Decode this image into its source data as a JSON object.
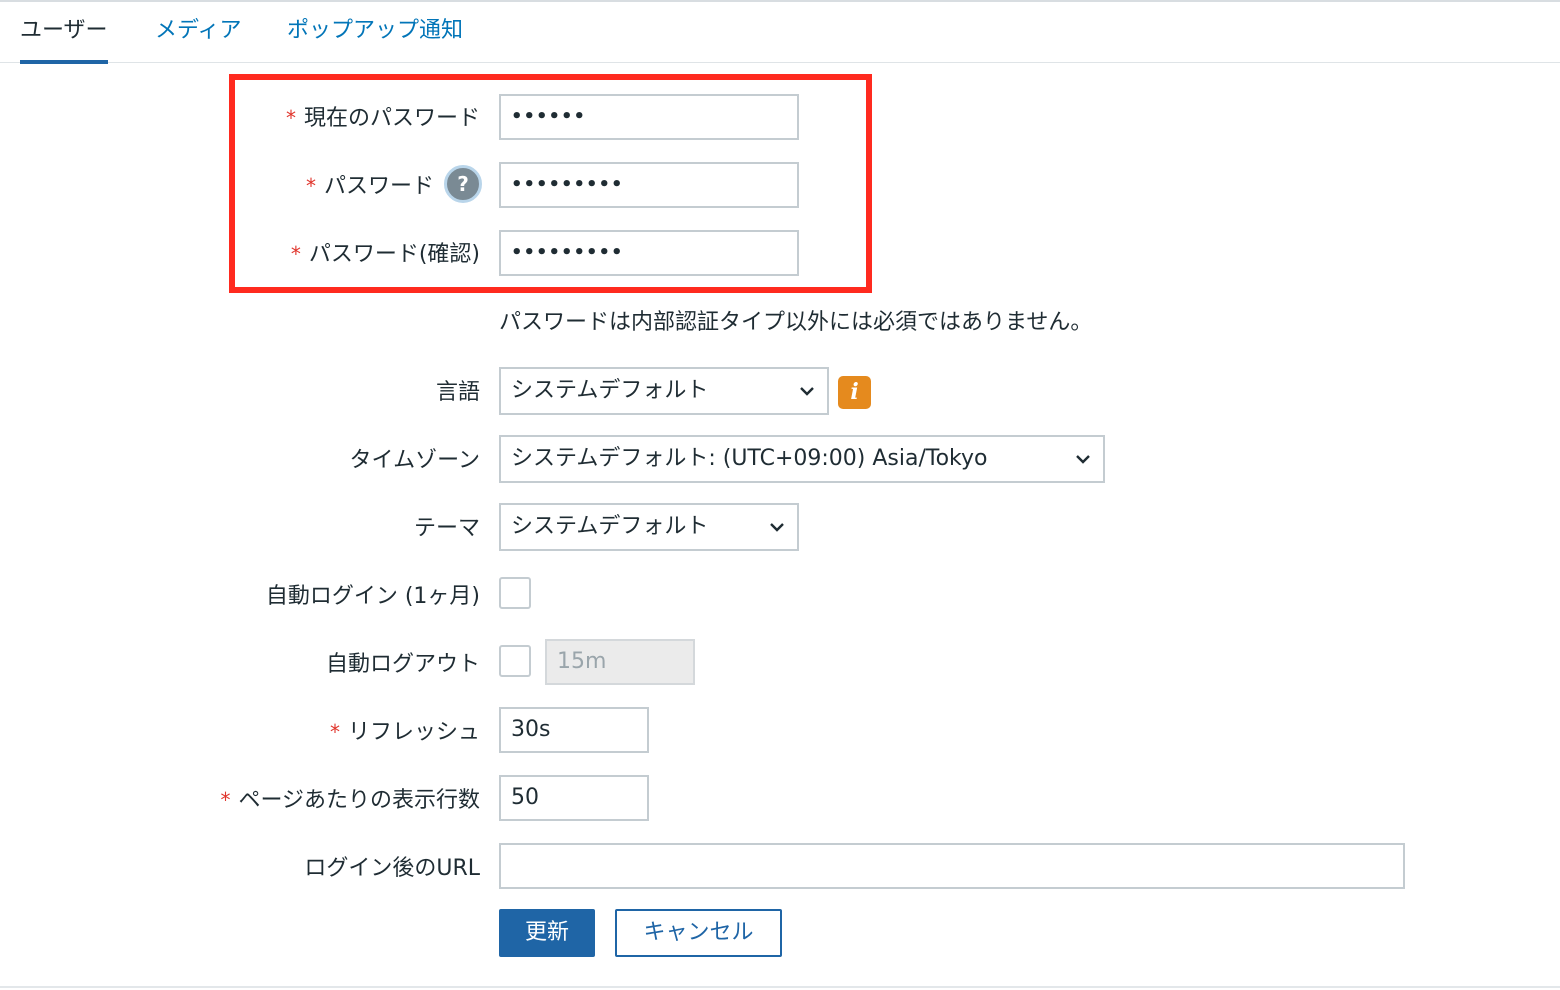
{
  "tabs": [
    {
      "label": "ユーザー",
      "active": true
    },
    {
      "label": "メディア",
      "active": false
    },
    {
      "label": "ポップアップ通知",
      "active": false
    }
  ],
  "form": {
    "current_password": {
      "label": "現在のパスワード",
      "required": true,
      "value": "••••••"
    },
    "password": {
      "label": "パスワード",
      "required": true,
      "value": "•••••••••",
      "help_icon": "question-icon"
    },
    "password_confirm": {
      "label": "パスワード(確認)",
      "required": true,
      "value": "•••••••••"
    },
    "password_note": "パスワードは内部認証タイプ以外には必須ではありません。",
    "language": {
      "label": "言語",
      "value": "システムデフォルト",
      "info_icon": "info-icon"
    },
    "timezone": {
      "label": "タイムゾーン",
      "value": "システムデフォルト: (UTC+09:00) Asia/Tokyo"
    },
    "theme": {
      "label": "テーマ",
      "value": "システムデフォルト"
    },
    "autologin": {
      "label": "自動ログイン (1ヶ月)",
      "checked": false
    },
    "autologout": {
      "label": "自動ログアウト",
      "checked": false,
      "value": "15m"
    },
    "refresh": {
      "label": "リフレッシュ",
      "required": true,
      "value": "30s"
    },
    "rows_per_page": {
      "label": "ページあたりの表示行数",
      "required": true,
      "value": "50"
    },
    "url_after_login": {
      "label": "ログイン後のURL",
      "value": ""
    },
    "required_mark": "*"
  },
  "buttons": {
    "update": "更新",
    "cancel": "キャンセル"
  },
  "colors": {
    "accent": "#1f65a6",
    "link": "#0275b8",
    "required": "#e0352c",
    "highlight": "#ff2a1f",
    "info": "#e58a1e"
  }
}
